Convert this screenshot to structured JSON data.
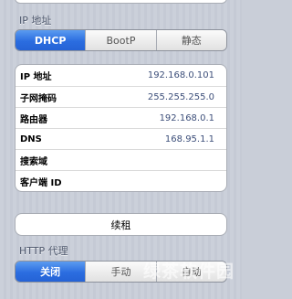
{
  "ip_section": {
    "label": "IP 地址",
    "modes": [
      {
        "label": "DHCP",
        "active": true
      },
      {
        "label": "BootP",
        "active": false
      },
      {
        "label": "静态",
        "active": false
      }
    ]
  },
  "network_info": [
    {
      "label": "IP 地址",
      "value": "192.168.0.101"
    },
    {
      "label": "子网掩码",
      "value": "255.255.255.0"
    },
    {
      "label": "路由器",
      "value": "192.168.0.1"
    },
    {
      "label": "DNS",
      "value": "168.95.1.1"
    },
    {
      "label": "搜索域",
      "value": ""
    },
    {
      "label": "客户端 ID",
      "value": ""
    }
  ],
  "renew_button": {
    "label": "续租"
  },
  "http_proxy": {
    "label": "HTTP 代理",
    "modes": [
      {
        "label": "关闭",
        "active": true
      },
      {
        "label": "手动",
        "active": false
      },
      {
        "label": "自动",
        "active": false
      }
    ]
  },
  "watermark": "绿茶软件园",
  "colors": {
    "accent": "#2b6de0",
    "background": "#c9ced8"
  }
}
